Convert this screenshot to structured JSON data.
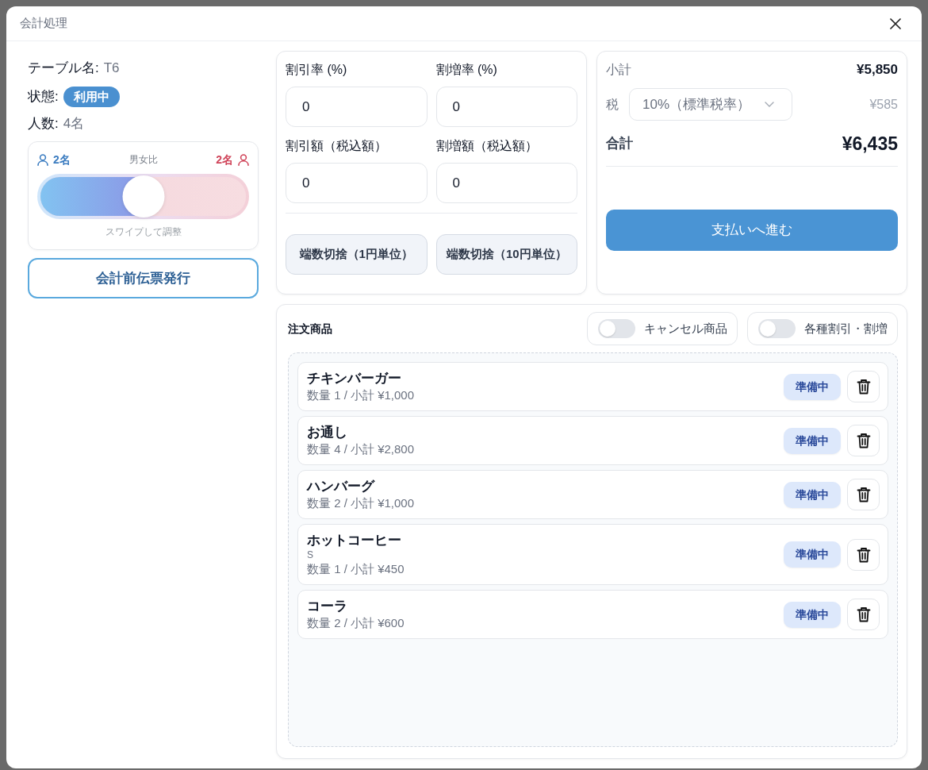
{
  "dialog": {
    "title": "会計処理"
  },
  "table_info": {
    "table_label": "テーブル名:",
    "table_value": "T6",
    "status_label": "状態:",
    "status": "利用中",
    "guests_label": "人数:",
    "guests_value": "4名"
  },
  "gender_ratio": {
    "male_count": "2名",
    "title": "男女比",
    "female_count": "2名",
    "level": 0.5,
    "hint": "スワイプして調整"
  },
  "pre_bill_button": "会計前伝票発行",
  "adjustments": {
    "fields": [
      {
        "label": "割引率 (%)",
        "value": "0"
      },
      {
        "label": "割増率 (%)",
        "value": "0"
      },
      {
        "label": "割引額（税込額）",
        "value": "0"
      },
      {
        "label": "割増額（税込額）",
        "value": "0"
      }
    ],
    "rounding_buttons": [
      "端数切捨（1円単位）",
      "端数切捨（10円単位）"
    ]
  },
  "summary": {
    "subtotal_label": "小計",
    "subtotal": "¥5,850",
    "tax_label": "税",
    "tax_rate": "10%（標準税率）",
    "tax": "¥585",
    "total_label": "合計",
    "total": "¥6,435",
    "pay_button": "支払いへ進む"
  },
  "orders": {
    "title": "注文商品",
    "toggles": [
      {
        "label": "キャンセル商品",
        "on": false
      },
      {
        "label": "各種割引・割増",
        "on": false
      }
    ],
    "items": [
      {
        "name": "チキンバーガー",
        "detail": "数量 1 / 小計 ¥1,000",
        "status": "準備中"
      },
      {
        "name": "お通し",
        "detail": "数量 4 / 小計 ¥2,800",
        "status": "準備中"
      },
      {
        "name": "ハンバーグ",
        "detail": "数量 2 / 小計 ¥1,000",
        "status": "準備中"
      },
      {
        "name": "ホットコーヒー",
        "option": "S",
        "detail": "数量 1 / 小計 ¥450",
        "status": "準備中"
      },
      {
        "name": "コーラ",
        "detail": "数量 2 / 小計 ¥600",
        "status": "準備中"
      }
    ]
  }
}
